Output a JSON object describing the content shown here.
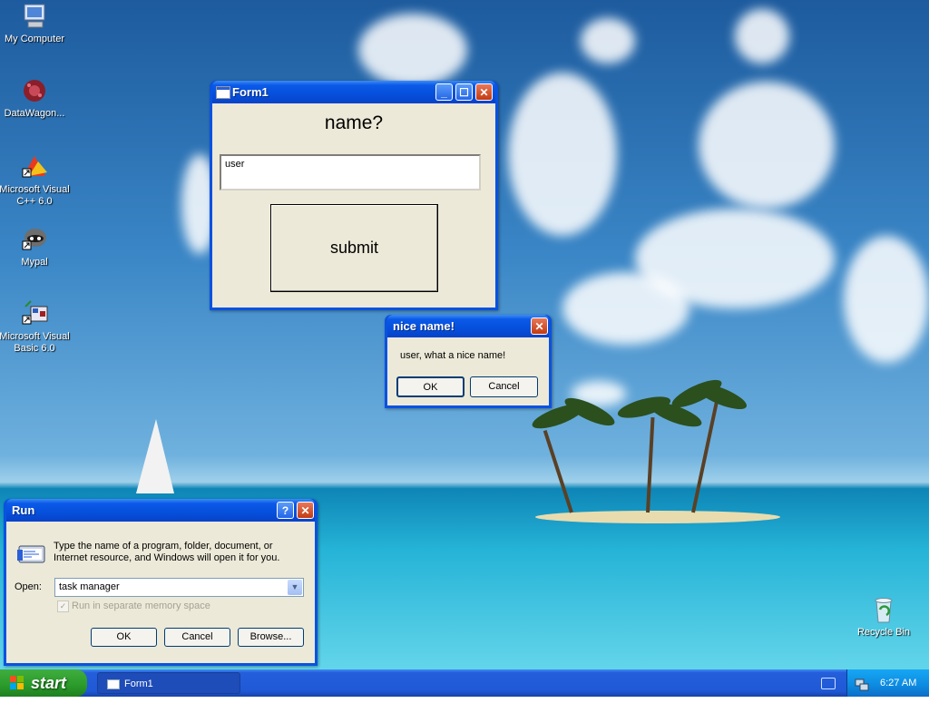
{
  "desktop": {
    "icons": [
      {
        "label": "My Computer",
        "icon": "my-computer-icon"
      },
      {
        "label": "DataWagon...",
        "icon": "datawagon-icon"
      },
      {
        "label": "Microsoft Visual C++ 6.0",
        "icon": "visual-cpp-icon"
      },
      {
        "label": "Mypal",
        "icon": "mypal-icon"
      },
      {
        "label": "Microsoft Visual Basic 6.0",
        "icon": "visual-basic-icon"
      },
      {
        "label": "Recycle Bin",
        "icon": "recycle-bin-icon"
      }
    ]
  },
  "form1": {
    "title": "Form1",
    "heading": "name?",
    "name_value": "user",
    "submit_label": "submit"
  },
  "msgbox": {
    "title": "nice name!",
    "message": "user, what a nice name!",
    "ok_label": "OK",
    "cancel_label": "Cancel"
  },
  "run": {
    "title": "Run",
    "help_button": "?",
    "description": "Type the name of a program, folder, document, or Internet resource, and Windows will open it for you.",
    "open_label": "Open:",
    "open_value": "task manager",
    "checkbox_label": "Run in separate memory space",
    "ok_label": "OK",
    "cancel_label": "Cancel",
    "browse_label": "Browse..."
  },
  "taskbar": {
    "start_label": "start",
    "task_button": "Form1",
    "clock": "6:27 AM"
  },
  "colors": {
    "titlebar": "#0550dc",
    "window_face": "#ece9d8",
    "start_green": "#2a9a2a",
    "close_red": "#c33b13"
  }
}
